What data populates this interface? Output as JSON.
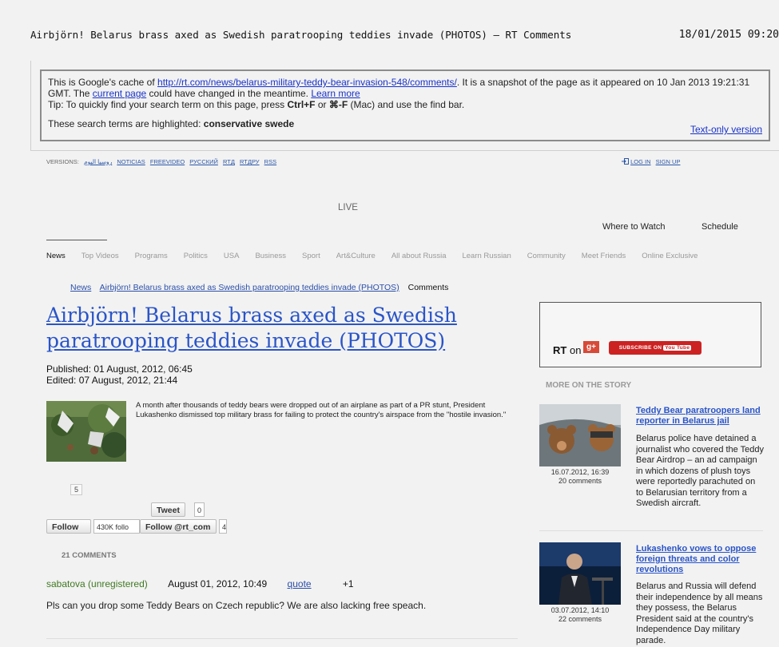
{
  "window": {
    "title": "Airbjörn! Belarus brass axed as Swedish paratrooping teddies invade (PHOTOS) — RT Comments",
    "date": "18/01/2015 09:20"
  },
  "cache_notice": {
    "p1": "This is Google's cache of ",
    "url": "http://rt.com/news/belarus-military-teddy-bear-invasion-548/comments/",
    "p2": ". It is a snapshot of the page as it appeared on 10 Jan 2013 19:21:31 GMT. The ",
    "current_page": "current page",
    "p3": " could have changed in the meantime. ",
    "learn_more": "Learn more",
    "tip_a": "Tip: To quickly find your search term on this page, press ",
    "tip_b": "Ctrl+F",
    "tip_c": " or ",
    "tip_d": "⌘-F",
    "tip_e": " (Mac) and use the find bar.",
    "highlighted_label": "These search terms are highlighted: ",
    "highlighted_terms": "conservative swede",
    "text_only": "Text-only version"
  },
  "versions": {
    "label": "VERSIONS:",
    "items": [
      "روسيا اليوم",
      "NOTICIAS",
      "FREEVIDEO",
      "РУССКИЙ",
      "RTД",
      "RTДРУ",
      "RSS"
    ]
  },
  "auth": {
    "login": "LOG IN",
    "signup": "SIGN UP"
  },
  "live": "LIVE",
  "where_to_watch": "Where to Watch",
  "schedule": "Schedule",
  "nav": [
    "News",
    "Top Videos",
    "Programs",
    "Politics",
    "USA",
    "Business",
    "Sport",
    "Art&Culture",
    "All about Russia",
    "Learn Russian",
    "Community",
    "Meet Friends",
    "Online Exclusive"
  ],
  "breadcrumb": {
    "news": "News",
    "article": "Airbjörn! Belarus brass axed as Swedish paratrooping teddies invade (PHOTOS)",
    "current": "Comments"
  },
  "article": {
    "title": "Airbjörn! Belarus brass axed as Swedish paratrooping teddies invade (PHOTOS)",
    "published": "Published: 01 August, 2012, 06:45",
    "edited": "Edited: 07 August, 2012, 21:44",
    "lead": "A month after thousands of teddy bears were dropped out of an airplane as part of a PR stunt, President Lukashenko dismissed top military brass for failing to protect the country's airspace from the \"hostile invasion.\""
  },
  "social": {
    "share_count": "5",
    "tweet": "Tweet",
    "tweet_count": "0",
    "follow": "Follow",
    "followers": "430K follo",
    "follow_rt": "Follow @rt_com",
    "follow_rt_count": "4"
  },
  "comments": {
    "header": "21 COMMENTS",
    "items": [
      {
        "author": "sabatova (unregistered)",
        "date": "August 01, 2012, 10:49",
        "quote": "quote",
        "score": "+1",
        "text": "Pls can you drop some Teddy Bears on Czech republic? We are also lacking free speach."
      }
    ]
  },
  "sidebar": {
    "rt_on": "RT",
    "on": "on",
    "gplus": "g+",
    "subscribe": "SUBSCRIBE ON",
    "youtube": "You Tube",
    "more_header": "MORE ON THE STORY",
    "stories": [
      {
        "title": "Teddy Bear paratroopers land reporter in Belarus jail",
        "date": "16.07.2012, 16:39",
        "comments": "20 comments",
        "body": "Belarus police have detained a journalist who covered the Teddy Bear Airdrop – an ad campaign in which dozens of plush toys were reportedly parachuted on to Belarusian territory from a Swedish aircraft."
      },
      {
        "title": "Lukashenko vows to oppose foreign threats and color revolutions",
        "date": "03.07.2012, 14:10",
        "comments": "22 comments",
        "body": "Belarus and Russia will defend their independence by all means they possess, the Belarus President said at the country's Independence Day military parade."
      }
    ]
  }
}
